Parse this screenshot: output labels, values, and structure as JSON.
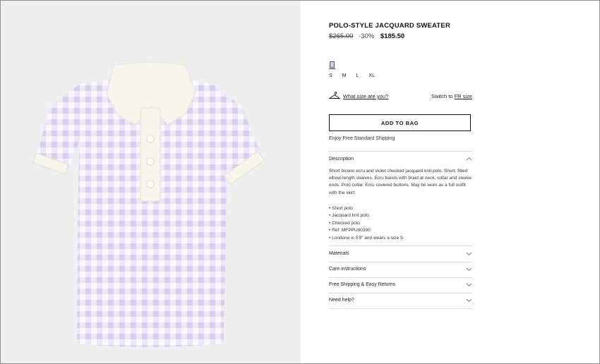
{
  "product": {
    "title": "POLO-STYLE JACQUARD SWEATER",
    "old_price": "$265.00",
    "discount": "-30%",
    "new_price": "$185.50",
    "swatch_color": "#d9d0ee",
    "sizes": [
      "S",
      "M",
      "L",
      "XL"
    ]
  },
  "size_guide": {
    "what_size": "What size are you?",
    "switch_prefix": "Switch to",
    "switch_link": "FR size"
  },
  "cart": {
    "add_label": "ADD TO BAG",
    "shipping_note": "Enjoy Free Standard Shipping"
  },
  "description": {
    "heading": "Description",
    "text": "Short bicolor ecru and violet checked jacquard knit polo. Short, fitted elbow-length sleeves. Ecru bands with braid at neck, collar and sleeve ends. Polo collar. Ecru covered buttons. May be worn as a full outfit with the skirt.",
    "bullets": [
      "Short polo",
      "Jacquard knit polo",
      "Checked polo",
      "Ref: MFPPU00390",
      "Londone is 5'8\" and wears a size S"
    ]
  },
  "accordions": [
    {
      "label": "Materials"
    },
    {
      "label": "Care instructions"
    },
    {
      "label": "Free Shipping & Easy Returns"
    },
    {
      "label": "Need help?"
    }
  ],
  "colors": {
    "lilac": "#d9cdee",
    "ecru": "#f8f5ec",
    "panel_bg": "#efefef"
  }
}
